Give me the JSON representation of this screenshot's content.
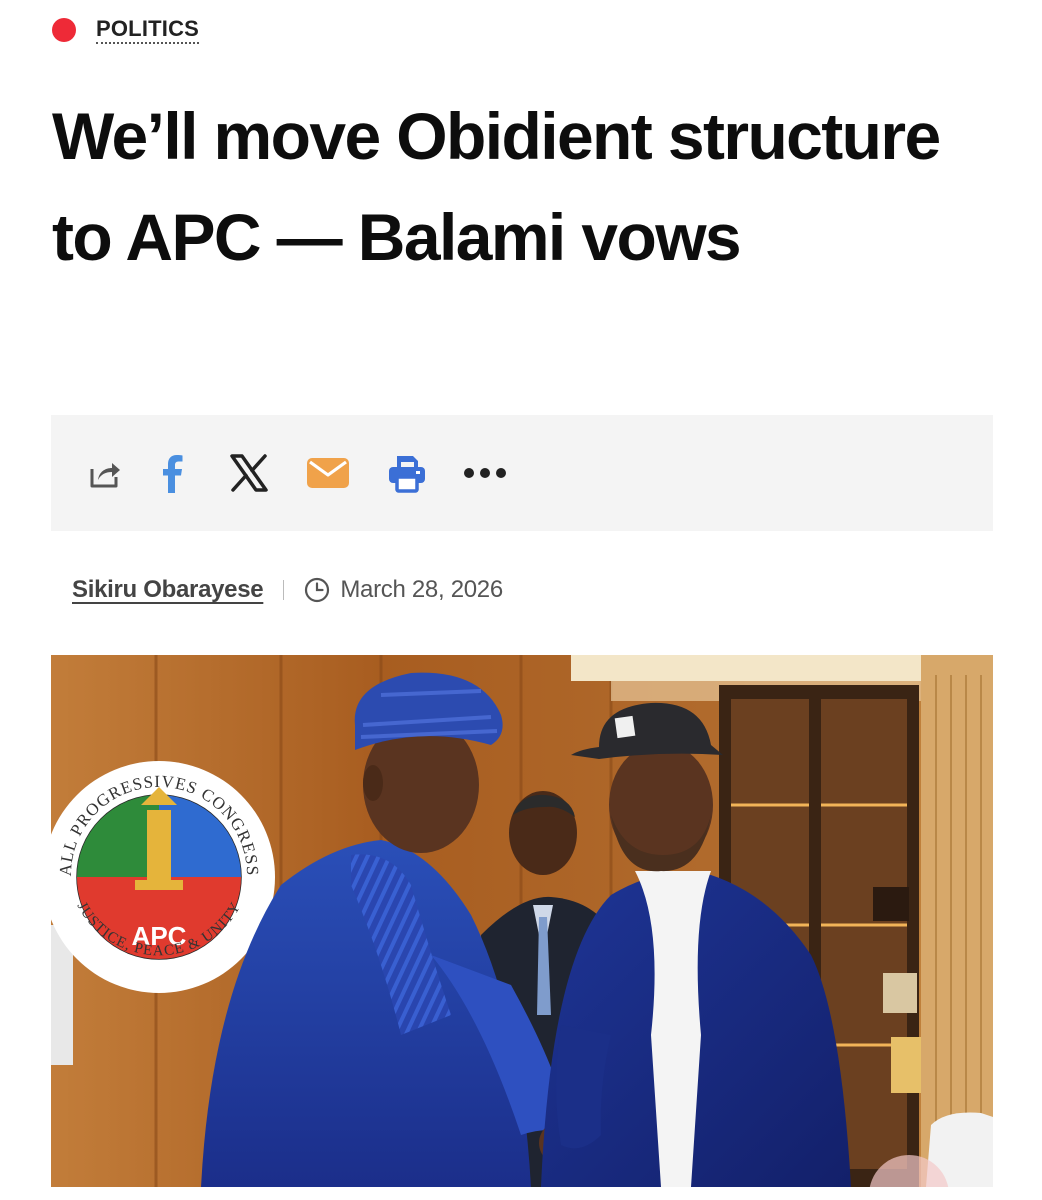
{
  "category": {
    "label": "POLITICS",
    "dot_color": "#ee2a37"
  },
  "article": {
    "headline": "We’ll move Obidient structure to APC — Balami vows",
    "author": "Sikiru Obarayese",
    "date": "March 28, 2026"
  },
  "share": {
    "icons": [
      "share-icon",
      "facebook-icon",
      "x-icon",
      "email-icon",
      "print-icon",
      "more-icon"
    ],
    "colors": {
      "facebook": "#4a8fe0",
      "email": "#f0a24a",
      "print": "#3b6fd6",
      "dark": "#222222"
    }
  },
  "photo": {
    "description_icons": [
      "apc-logo"
    ],
    "logo": {
      "top_text": "ALL PROGRESSIVES CONGRESS",
      "bottom_text": "JUSTICE, PEACE & UNITY",
      "abbr": "APC"
    }
  }
}
